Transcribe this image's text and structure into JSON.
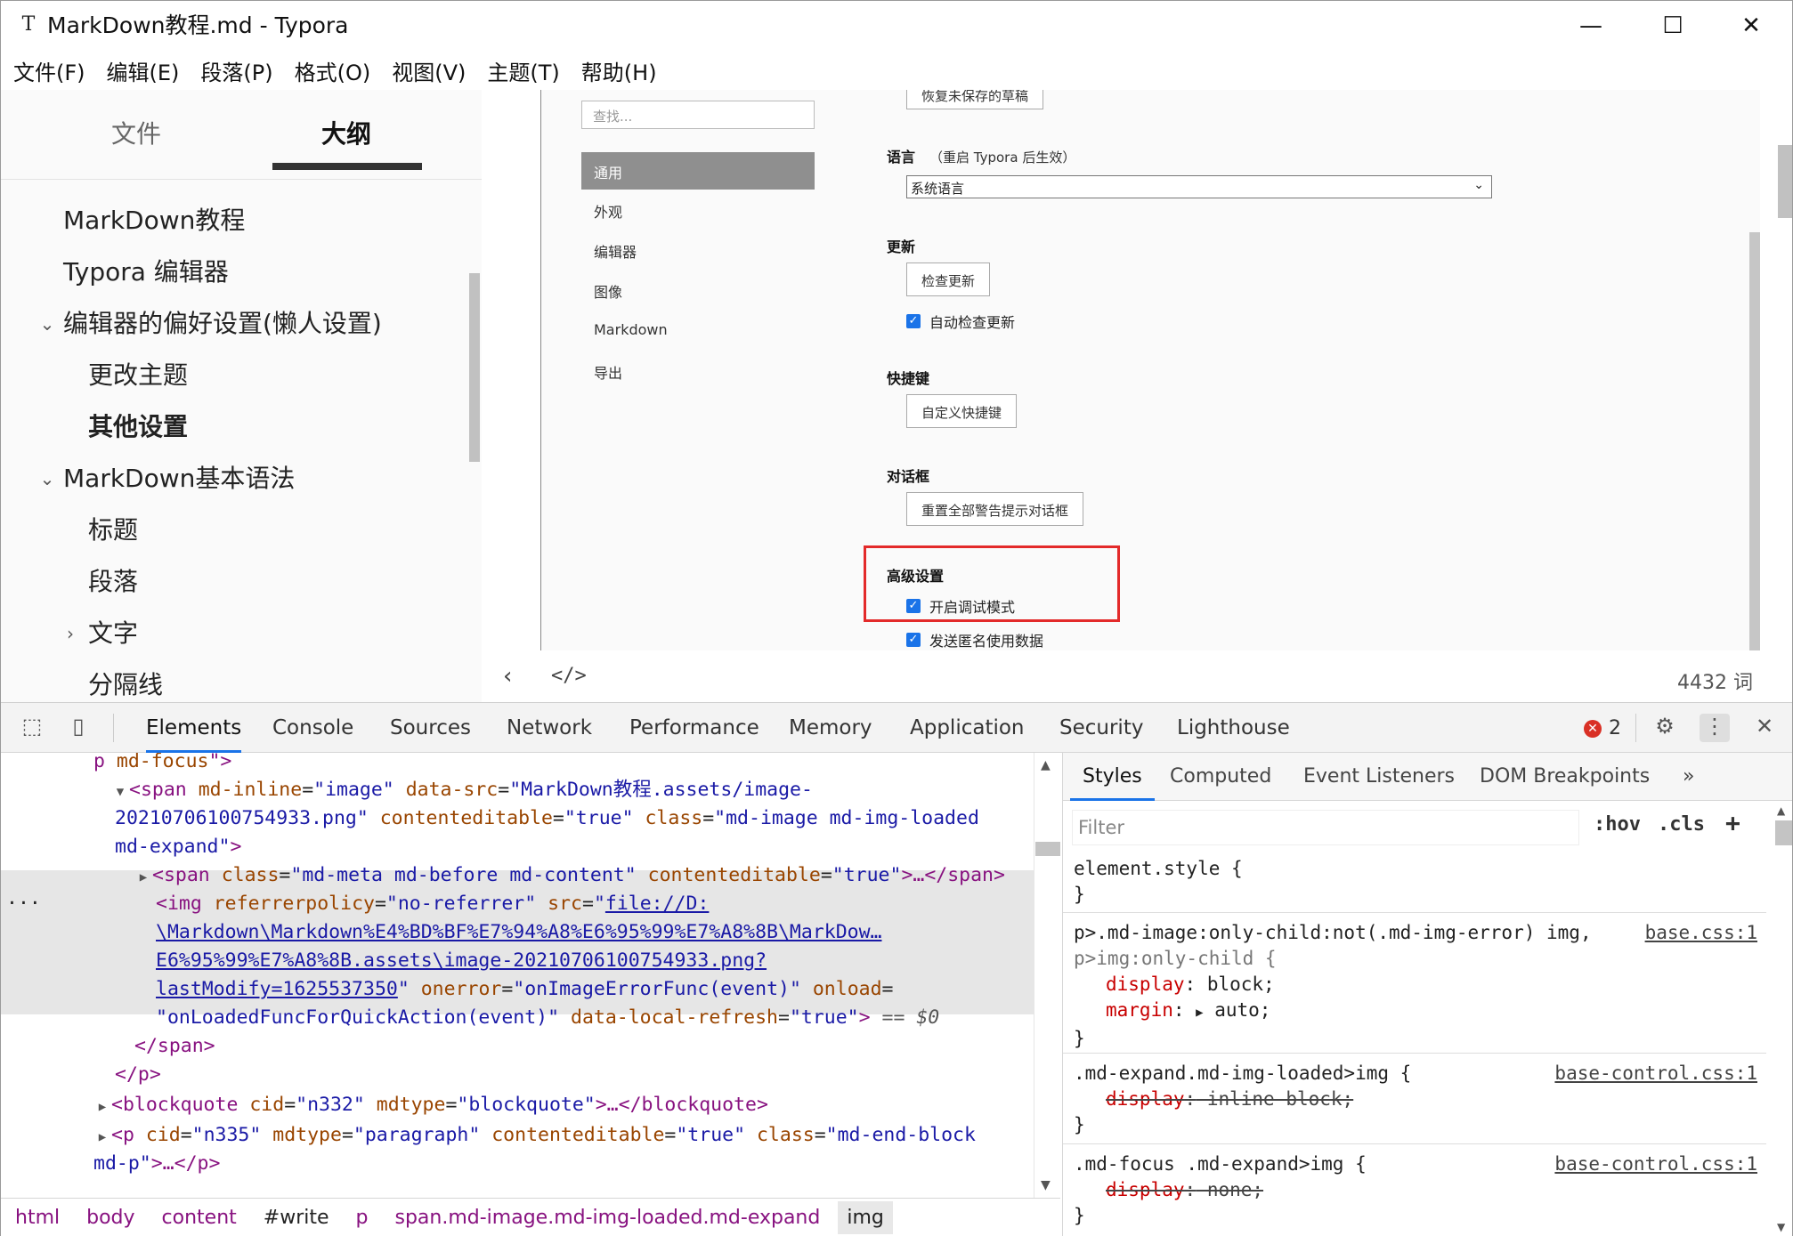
{
  "window": {
    "logo": "T",
    "title": "MarkDown教程.md - Typora",
    "minimize": "—",
    "maximize": "☐",
    "close": "✕"
  },
  "menu": [
    "文件(F)",
    "编辑(E)",
    "段落(P)",
    "格式(O)",
    "视图(V)",
    "主题(T)",
    "帮助(H)"
  ],
  "sidebar": {
    "tabs": {
      "files": "文件",
      "outline": "大纲"
    },
    "outline": [
      {
        "label": "MarkDown教程",
        "level": 1,
        "expander": ""
      },
      {
        "label": "Typora 编辑器",
        "level": 1,
        "expander": ""
      },
      {
        "label": "编辑器的偏好设置(懒人设置)",
        "level": 1,
        "expander": "⌄"
      },
      {
        "label": "更改主题",
        "level": 2,
        "expander": ""
      },
      {
        "label": "其他设置",
        "level": 2,
        "expander": "",
        "bold": true
      },
      {
        "label": "MarkDown基本语法",
        "level": 1,
        "expander": "⌄"
      },
      {
        "label": "标题",
        "level": 2,
        "expander": ""
      },
      {
        "label": "段落",
        "level": 2,
        "expander": ""
      },
      {
        "label": "文字",
        "level": 2,
        "expander": "›"
      },
      {
        "label": "分隔线",
        "level": 2,
        "expander": ""
      }
    ]
  },
  "prefs": {
    "search_placeholder": "查找...",
    "nav": [
      "通用",
      "外观",
      "编辑器",
      "图像",
      "Markdown",
      "导出"
    ],
    "restore_button": "恢复未保存的草稿",
    "language_title": "语言",
    "language_note": "（重启 Typora 后生效）",
    "language_value": "系统语言",
    "update_title": "更新",
    "check_update_button": "检查更新",
    "auto_check_label": "自动检查更新",
    "shortcut_title": "快捷键",
    "custom_shortcut_button": "自定义快捷键",
    "dialog_title": "对话框",
    "reset_dialog_button": "重置全部警告提示对话框",
    "advanced_title": "高级设置",
    "debug_label": "开启调试模式",
    "anon_label": "发送匿名使用数据"
  },
  "editor_footer": {
    "back": "‹",
    "source": "</>",
    "word_count": "4432 词"
  },
  "devtools": {
    "tabs": [
      "Elements",
      "Console",
      "Sources",
      "Network",
      "Performance",
      "Memory",
      "Application",
      "Security",
      "Lighthouse"
    ],
    "error_count": "2",
    "error_icon": "✕",
    "elements": {
      "l0": {
        "tag": "p",
        "attr": "md-focus",
        "tail": "\">"
      },
      "l1": {
        "open": "<span",
        "a1": "md-inline",
        "v1": "\"image\"",
        "a2": "data-src",
        "v2": "\"MarkDown教程.assets/image-"
      },
      "l2": {
        "v2b": "20210706100754933.png\"",
        "a3": "contenteditable",
        "v3": "\"true\"",
        "a4": "class",
        "v4": "\"md-image md-img-loaded"
      },
      "l3": {
        "v4b": "md-expand\"",
        "close": ">"
      },
      "l4": {
        "open": "<span",
        "a1": "class",
        "v1": "\"md-meta md-before md-content\"",
        "a2": "contenteditable",
        "v2": "\"true\"",
        "rest": ">…</span>"
      },
      "l5": {
        "open": "<img",
        "a1": "referrerpolicy",
        "v1": "\"no-referrer\"",
        "a2": "src",
        "v2": "file://D:"
      },
      "l6": {
        "v2b": "\\Markdown\\Markdown%E4%BD%BF%E7%94%A8%E6%95%99%E7%A8%8B\\MarkDow…"
      },
      "l7": {
        "v2c": "E6%95%99%E7%A8%8B.assets\\image-20210706100754933.png?"
      },
      "l8": {
        "v2d": "lastModify=1625537350",
        "a3": "onerror",
        "v3": "\"onImageErrorFunc(event)\"",
        "a4": "onload"
      },
      "l9": {
        "v4": "\"onLoadedFuncForQuickAction(event)\"",
        "a5": "data-local-refresh",
        "v5": "\"true\"",
        "marker": "== $0"
      },
      "l10": "</span>",
      "l11": "</p>",
      "l12": {
        "open": "<blockquote",
        "a1": "cid",
        "v1": "\"n332\"",
        "a2": "mdtype",
        "v2": "\"blockquote\"",
        "rest": ">…</blockquote>"
      },
      "l13": {
        "open": "<p",
        "a1": "cid",
        "v1": "\"n335\"",
        "a2": "mdtype",
        "v2": "\"paragraph\"",
        "a3": "contenteditable",
        "v3": "\"true\"",
        "a4": "class",
        "v4": "\"md-end-block"
      },
      "l14": {
        "v4b": "md-p\"",
        "rest": ">…</p>"
      },
      "ellipsis": "···"
    },
    "breadcrumb": [
      "html",
      "body",
      "content",
      "#write",
      "p",
      "span.md-image.md-img-loaded.md-expand",
      "img"
    ],
    "styles": {
      "tabs": [
        "Styles",
        "Computed",
        "Event Listeners",
        "DOM Breakpoints",
        "»"
      ],
      "filter_placeholder": "Filter",
      "hov": ":hov",
      "cls": ".cls",
      "plus": "+",
      "rules": {
        "r1": {
          "sel": "element.style {",
          "end": "}"
        },
        "r2": {
          "sel1": "p>.md-image:only-child:not(.md-img-error) img,",
          "sel2": "p>img:only-child {",
          "src": "base.css:1",
          "p1": "display",
          "v1": " block;",
          "p2": "margin",
          "v2": " auto;",
          "end": "}"
        },
        "r3": {
          "sel": ".md-expand.md-img-loaded>img {",
          "src": "base-control.css:1",
          "p1": "display",
          "v1": " inline-block;",
          "end": "}"
        },
        "r4": {
          "sel": ".md-focus .md-expand>img {",
          "src": "base-control.css:1",
          "p1": "display",
          "v1": " none;",
          "end": "}"
        }
      }
    }
  }
}
